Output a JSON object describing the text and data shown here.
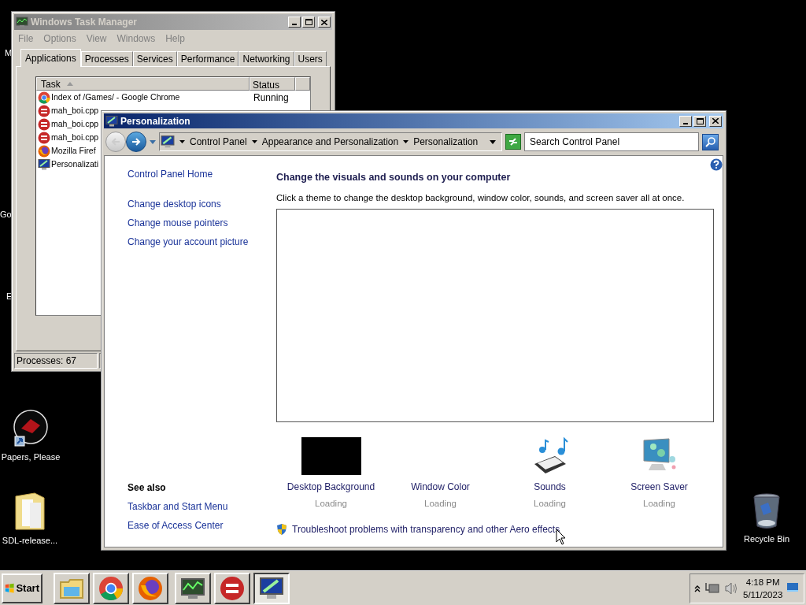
{
  "desktop": {
    "icons": [
      {
        "label": "M",
        "kind": "cut"
      },
      {
        "label": "Go",
        "kind": "cut"
      },
      {
        "label": "E",
        "kind": "cut"
      },
      {
        "label": "Papers, Please",
        "kind": "game"
      },
      {
        "label": "SDL-release...",
        "kind": "folder"
      },
      {
        "label": "Recycle Bin",
        "kind": "bin"
      }
    ]
  },
  "task_manager": {
    "title": "Windows Task Manager",
    "active": false,
    "menu": [
      "File",
      "Options",
      "View",
      "Windows",
      "Help"
    ],
    "tabs": [
      {
        "label": "Applications",
        "selected": true
      },
      {
        "label": "Processes",
        "selected": false
      },
      {
        "label": "Services",
        "selected": false
      },
      {
        "label": "Performance",
        "selected": false
      },
      {
        "label": "Networking",
        "selected": false
      },
      {
        "label": "Users",
        "selected": false
      }
    ],
    "columns": [
      "Task",
      "Status"
    ],
    "rows": [
      {
        "task": "Index of /Games/ - Google Chrome",
        "status": "Running",
        "kind": "chrome"
      },
      {
        "task": "mah_boi.cpp",
        "kind": "devcpp"
      },
      {
        "task": "mah_boi.cpp",
        "kind": "devcpp"
      },
      {
        "task": "mah_boi.cpp",
        "kind": "devcpp"
      },
      {
        "task": "Mozilla Firef",
        "kind": "firefox"
      },
      {
        "task": "Personalizati",
        "kind": "monitor"
      }
    ],
    "status_bar": "Processes: 67"
  },
  "personalization": {
    "title": "Personalization",
    "active": true,
    "breadcrumb": [
      "Control Panel",
      "Appearance and Personalization",
      "Personalization"
    ],
    "search": {
      "placeholder": "Search Control Panel"
    },
    "sidebar": {
      "links": [
        "Control Panel Home",
        "Change desktop icons",
        "Change mouse pointers",
        "Change your account picture"
      ],
      "see_also_title": "See also",
      "see_also": [
        "Taskbar and Start Menu",
        "Ease of Access Center"
      ]
    },
    "heading": "Change the visuals and sounds on your computer",
    "subtitle": "Click a theme to change the desktop background, window color, sounds, and screen saver all at once.",
    "items": [
      {
        "label": "Desktop Background",
        "status": "Loading",
        "kind": "background"
      },
      {
        "label": "Window Color",
        "status": "Loading",
        "kind": "none"
      },
      {
        "label": "Sounds",
        "status": "Loading",
        "kind": "sounds"
      },
      {
        "label": "Screen Saver",
        "status": "Loading",
        "kind": "screensaver"
      }
    ],
    "troubleshoot": "Troubleshoot problems with transparency and other Aero effects"
  },
  "taskbar": {
    "start": "Start",
    "buttons": [
      {
        "kind": "folder",
        "selected": false
      },
      {
        "kind": "chrome",
        "selected": false
      },
      {
        "kind": "firefox",
        "selected": false
      },
      {
        "kind": "taskmgr",
        "selected": false
      },
      {
        "kind": "devcpp",
        "selected": false
      },
      {
        "kind": "monitor",
        "selected": true
      }
    ],
    "time": "4:18 PM",
    "date": "5/11/2023"
  }
}
